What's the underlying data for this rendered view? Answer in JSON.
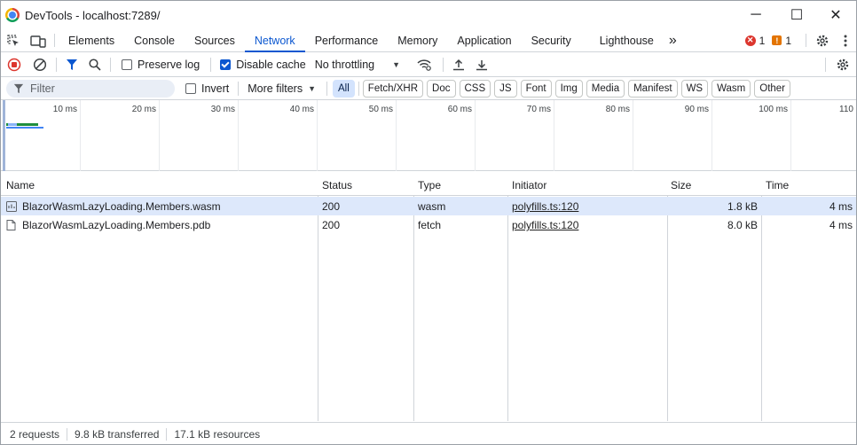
{
  "window": {
    "title": "DevTools - localhost:7289/",
    "controls": {
      "minimize": "─",
      "maximize": "☐",
      "close": "✕"
    }
  },
  "tabs": [
    "Elements",
    "Console",
    "Sources",
    "Network",
    "Performance",
    "Memory",
    "Application",
    "Security",
    "Lighthouse"
  ],
  "active_tab": "Network",
  "more_tabs_glyph": "»",
  "issues": {
    "errors": "1",
    "warnings": "1"
  },
  "toolbar": {
    "preserve_log": {
      "label": "Preserve log",
      "checked": false
    },
    "disable_cache": {
      "label": "Disable cache",
      "checked": true
    },
    "throttling": "No throttling"
  },
  "filter": {
    "placeholder": "Filter",
    "invert_label": "Invert",
    "more_filters_label": "More filters",
    "types": [
      "All",
      "Fetch/XHR",
      "Doc",
      "CSS",
      "JS",
      "Font",
      "Img",
      "Media",
      "Manifest",
      "WS",
      "Wasm",
      "Other"
    ],
    "selected_type": "All"
  },
  "overview": {
    "ticks": [
      "10 ms",
      "20 ms",
      "30 ms",
      "40 ms",
      "50 ms",
      "60 ms",
      "70 ms",
      "80 ms",
      "90 ms",
      "100 ms",
      "110"
    ]
  },
  "table": {
    "columns": [
      "Name",
      "Status",
      "Type",
      "Initiator",
      "Size",
      "Time"
    ],
    "rows": [
      {
        "name": "BlazorWasmLazyLoading.Members.wasm",
        "status": "200",
        "type": "wasm",
        "initiator": "polyfills.ts:120",
        "size": "1.8 kB",
        "time": "4 ms",
        "icon": "wasm-file-icon",
        "selected": true
      },
      {
        "name": "BlazorWasmLazyLoading.Members.pdb",
        "status": "200",
        "type": "fetch",
        "initiator": "polyfills.ts:120",
        "size": "8.0 kB",
        "time": "4 ms",
        "icon": "document-icon",
        "selected": false
      }
    ]
  },
  "status_bar": {
    "requests": "2 requests",
    "transferred": "9.8 kB transferred",
    "resources": "17.1 kB resources"
  },
  "colors": {
    "accent": "#0b57d0",
    "error": "#dc362e",
    "warning": "#e37400",
    "selected_row": "#dde8fb"
  }
}
